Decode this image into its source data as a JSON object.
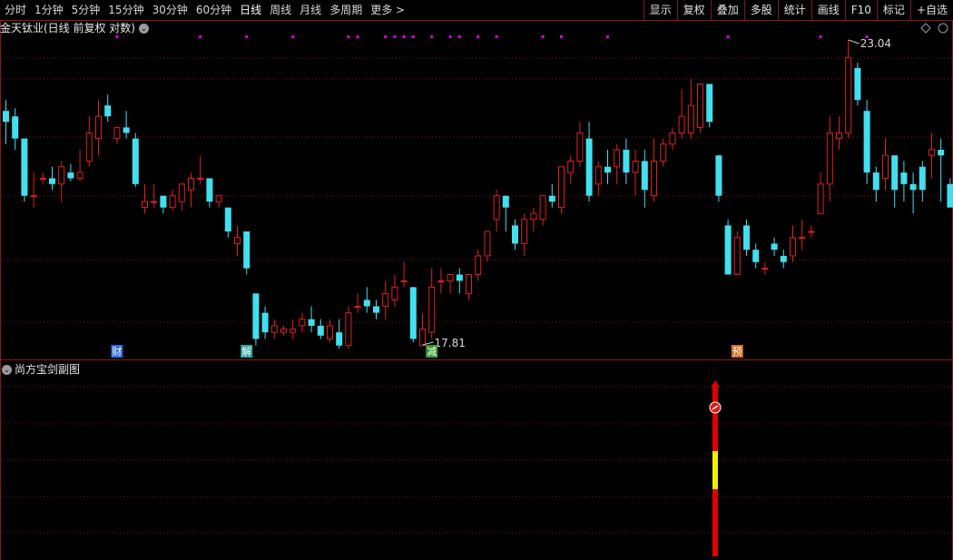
{
  "toolbar": {
    "periods": [
      "分时",
      "1分钟",
      "5分钟",
      "15分钟",
      "30分钟",
      "60分钟",
      "日线",
      "周线",
      "月线",
      "多周期",
      "更多 >"
    ],
    "active_index": 6,
    "right_buttons": [
      "显示",
      "复权",
      "叠加",
      "多股",
      "统计",
      "画线",
      "F10",
      "标记",
      "+自选"
    ]
  },
  "main": {
    "title": "金天钛业(日线 前复权 对数)",
    "high_label": "23.04",
    "low_label": "17.81",
    "markers": [
      {
        "text": "财",
        "color": "#2a6ad8"
      },
      {
        "text": "解",
        "color": "#2aa8a0"
      },
      {
        "text": "减",
        "color": "#2e9a2e"
      },
      {
        "text": "预",
        "color": "#d46a1a"
      }
    ]
  },
  "sub": {
    "title": "尚方宝剑副图",
    "signal_icon": "red-ball-arrow-icon"
  },
  "colors": {
    "up": "#e02020",
    "down": "#40e0f0",
    "grid": "#7a1a1a",
    "dot": "#e000e0",
    "sword_red": "#e00000",
    "sword_yellow": "#f0f000"
  },
  "chart_data": {
    "type": "candlestick",
    "y_scale": "log",
    "candles": [
      [
        21.7,
        21.9,
        21.5,
        21.1
      ],
      [
        21.6,
        21.75,
        21.2,
        21.0
      ],
      [
        21.2,
        21.2,
        20.2,
        20.1
      ],
      [
        20.2,
        20.6,
        20.2,
        20.0
      ],
      [
        20.5,
        20.6,
        20.5,
        20.4
      ],
      [
        20.5,
        20.7,
        20.4,
        20.3
      ],
      [
        20.4,
        20.8,
        20.7,
        20.1
      ],
      [
        20.6,
        20.75,
        20.5,
        20.45
      ],
      [
        20.5,
        21.0,
        20.6,
        20.45
      ],
      [
        20.8,
        21.6,
        21.3,
        20.7
      ],
      [
        21.2,
        21.9,
        21.6,
        20.9
      ],
      [
        21.8,
        22.0,
        21.6,
        21.5
      ],
      [
        21.2,
        21.3,
        21.4,
        21.1
      ],
      [
        21.4,
        21.7,
        21.3,
        21.2
      ],
      [
        21.2,
        21.3,
        20.4,
        20.35
      ],
      [
        20.0,
        20.4,
        20.1,
        19.9
      ],
      [
        20.1,
        20.4,
        20.1,
        20.0
      ],
      [
        20.2,
        20.2,
        20.0,
        19.9
      ],
      [
        20.0,
        20.3,
        20.2,
        19.95
      ],
      [
        20.1,
        20.3,
        20.4,
        19.95
      ],
      [
        20.3,
        20.6,
        20.5,
        20.0
      ],
      [
        20.5,
        20.9,
        20.5,
        20.4
      ],
      [
        20.5,
        20.5,
        20.1,
        20.0
      ],
      [
        20.1,
        20.2,
        20.2,
        20.0
      ],
      [
        20.0,
        20.0,
        19.6,
        19.5
      ],
      [
        19.4,
        19.7,
        19.5,
        19.2
      ],
      [
        19.6,
        19.6,
        19.0,
        18.9
      ],
      [
        18.6,
        18.6,
        17.9,
        17.8
      ],
      [
        18.3,
        18.4,
        18.0,
        17.9
      ],
      [
        18.0,
        18.2,
        18.1,
        17.9
      ],
      [
        18.0,
        18.1,
        18.05,
        17.95
      ],
      [
        18.0,
        18.2,
        18.05,
        17.9
      ],
      [
        18.1,
        18.3,
        18.2,
        18.0
      ],
      [
        18.2,
        18.4,
        18.1,
        18.0
      ],
      [
        18.1,
        18.2,
        17.95,
        17.9
      ],
      [
        17.9,
        18.2,
        18.1,
        17.85
      ],
      [
        18.0,
        18.2,
        17.8,
        17.75
      ],
      [
        17.8,
        18.4,
        18.3,
        17.75
      ],
      [
        18.4,
        18.6,
        18.4,
        18.3
      ],
      [
        18.5,
        18.7,
        18.4,
        18.3
      ],
      [
        18.4,
        18.5,
        18.3,
        18.2
      ],
      [
        18.4,
        18.8,
        18.6,
        18.2
      ],
      [
        18.5,
        18.9,
        18.7,
        18.4
      ],
      [
        18.8,
        19.1,
        18.8,
        18.7
      ],
      [
        18.7,
        18.7,
        17.9,
        17.85
      ],
      [
        17.8,
        18.3,
        18.05,
        17.81
      ],
      [
        18.0,
        19.0,
        18.7,
        17.9
      ],
      [
        18.8,
        19.0,
        18.8,
        18.6
      ],
      [
        18.8,
        18.9,
        18.9,
        18.6
      ],
      [
        18.9,
        19.0,
        18.8,
        18.6
      ],
      [
        18.6,
        18.9,
        18.9,
        18.5
      ],
      [
        18.9,
        19.3,
        19.2,
        18.8
      ],
      [
        19.2,
        19.5,
        19.6,
        19.1
      ],
      [
        19.8,
        20.3,
        20.2,
        19.6
      ],
      [
        20.2,
        20.2,
        20.0,
        19.6
      ],
      [
        19.7,
        19.8,
        19.4,
        19.3
      ],
      [
        19.4,
        19.9,
        19.8,
        19.2
      ],
      [
        19.8,
        20.0,
        19.9,
        19.6
      ],
      [
        19.8,
        20.2,
        20.2,
        19.7
      ],
      [
        20.2,
        20.4,
        20.1,
        20.0
      ],
      [
        20.0,
        20.7,
        20.7,
        19.9
      ],
      [
        20.6,
        20.9,
        20.8,
        20.4
      ],
      [
        20.8,
        21.5,
        21.3,
        20.7
      ],
      [
        21.2,
        21.5,
        20.2,
        20.1
      ],
      [
        20.4,
        20.8,
        20.7,
        20.2
      ],
      [
        20.7,
        21.0,
        20.6,
        20.4
      ],
      [
        20.7,
        21.1,
        21.0,
        20.4
      ],
      [
        21.0,
        21.2,
        20.6,
        20.4
      ],
      [
        20.6,
        21.0,
        20.8,
        20.2
      ],
      [
        20.8,
        21.0,
        20.3,
        20.0
      ],
      [
        20.2,
        21.2,
        20.8,
        20.1
      ],
      [
        20.8,
        21.2,
        21.1,
        20.7
      ],
      [
        21.1,
        21.4,
        21.3,
        21.0
      ],
      [
        21.3,
        22.1,
        21.6,
        21.2
      ],
      [
        21.3,
        22.3,
        21.8,
        21.2
      ],
      [
        21.4,
        22.0,
        22.2,
        21.3
      ],
      [
        22.2,
        22.1,
        21.5,
        21.4
      ],
      [
        20.9,
        20.9,
        20.2,
        20.1
      ],
      [
        19.7,
        19.8,
        18.9,
        18.9
      ],
      [
        18.9,
        19.6,
        19.5,
        18.9
      ],
      [
        19.7,
        19.8,
        19.3,
        19.2
      ],
      [
        19.3,
        19.4,
        19.1,
        19.0
      ],
      [
        19.0,
        19.1,
        19.0,
        18.9
      ],
      [
        19.4,
        19.5,
        19.3,
        19.2
      ],
      [
        19.2,
        19.3,
        19.1,
        19.0
      ],
      [
        19.2,
        19.7,
        19.5,
        19.1
      ],
      [
        19.5,
        19.8,
        19.5,
        19.3
      ],
      [
        19.6,
        19.7,
        19.6,
        19.5
      ],
      [
        19.9,
        20.6,
        20.4,
        19.9
      ],
      [
        20.4,
        21.6,
        21.3,
        20.1
      ],
      [
        21.2,
        21.6,
        21.3,
        21.0
      ],
      [
        21.3,
        23.04,
        22.7,
        21.2
      ],
      [
        22.5,
        22.6,
        21.9,
        21.8
      ],
      [
        21.7,
        21.9,
        20.6,
        20.4
      ],
      [
        20.6,
        20.7,
        20.3,
        20.1
      ],
      [
        20.5,
        21.2,
        20.9,
        20.3
      ],
      [
        20.9,
        20.9,
        20.3,
        20.0
      ],
      [
        20.6,
        20.8,
        20.4,
        20.1
      ],
      [
        20.4,
        20.6,
        20.3,
        19.9
      ],
      [
        20.7,
        20.8,
        20.3,
        20.1
      ],
      [
        20.9,
        21.3,
        21.0,
        20.5
      ],
      [
        21.0,
        21.2,
        20.9,
        20.1
      ],
      [
        20.4,
        20.5,
        20.0,
        20.0
      ]
    ],
    "marker_positions": [
      12,
      26,
      46,
      79
    ],
    "dot_positions": [
      12,
      21,
      26,
      31,
      37,
      38,
      41,
      42,
      43,
      44,
      46,
      48,
      49,
      51,
      53,
      58,
      60,
      65,
      78,
      88,
      93
    ]
  }
}
